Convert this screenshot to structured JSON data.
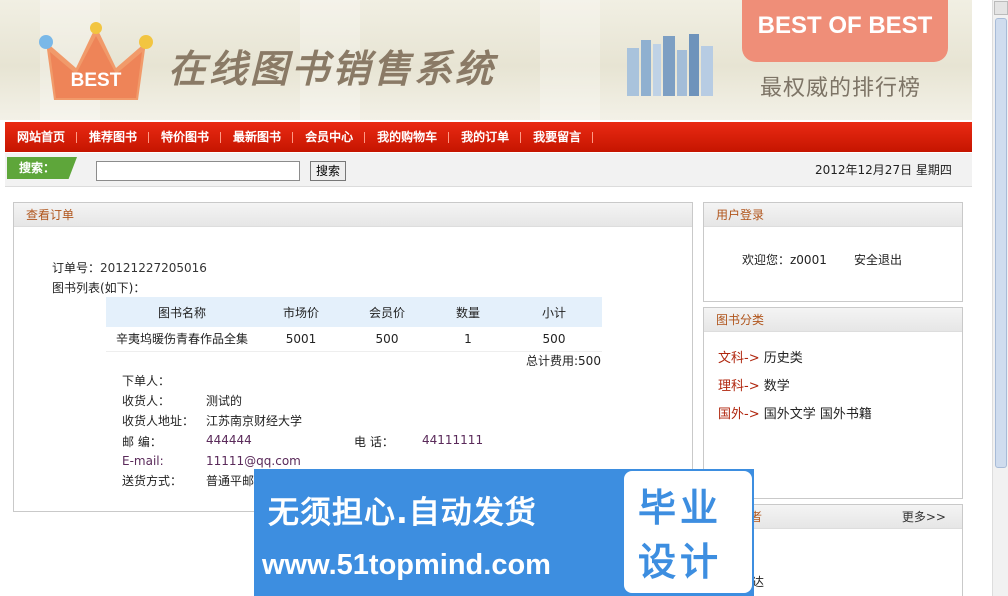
{
  "header": {
    "logo_text": "BEST",
    "site_title": "在线图书销售系统",
    "badge": "BEST OF BEST",
    "slogan": "最权威的排行榜"
  },
  "nav": {
    "items": [
      "网站首页",
      "推荐图书",
      "特价图书",
      "最新图书",
      "会员中心",
      "我的购物车",
      "我的订单",
      "我要留言"
    ]
  },
  "search": {
    "label": "搜索：",
    "value": "",
    "button": "搜索",
    "date": "2012年12月27日 星期四"
  },
  "order": {
    "title": "查看订单",
    "number_label": "订单号：",
    "number": "20121227205016",
    "list_label": "图书列表(如下)：",
    "columns": [
      "图书名称",
      "市场价",
      "会员价",
      "数量",
      "小计"
    ],
    "rows": [
      {
        "name": "辛夷坞暖伤青春作品全集",
        "market": "5001",
        "member": "500",
        "qty": "1",
        "subtotal": "500"
      }
    ],
    "total_label": "总计费用:",
    "total": "500",
    "buyer_label": "下单人：",
    "buyer": "",
    "receiver_label": "收货人：",
    "receiver": "测试的",
    "address_label": "收货人地址：",
    "address": "江苏南京财经大学",
    "zip_label": "邮 编：",
    "zip": "444444",
    "phone_label": "电 话：",
    "phone": "44111111",
    "email_label": "E-mail:",
    "email": "11111@qq.com",
    "shipping_label": "送货方式：",
    "shipping": "普通平邮"
  },
  "login": {
    "title": "用户登录",
    "welcome": "欢迎您：z0001",
    "logout": "安全退出"
  },
  "categories": {
    "title": "图书分类",
    "items": [
      {
        "lead": "文科->",
        "subs": "历史类"
      },
      {
        "lead": "理科->",
        "subs": "数学"
      },
      {
        "lead": "国外->",
        "subs": "国外文学  国外书籍"
      }
    ]
  },
  "bottom_panel": {
    "title_fragment": "者",
    "more": "更多>>",
    "item_fragment": "达"
  },
  "overlay": {
    "slogan": "无须担心.自动发货",
    "url": "www.51topmind.com",
    "box_line1": "毕业",
    "box_line2": "设计",
    "color": "#3d8ee0"
  }
}
